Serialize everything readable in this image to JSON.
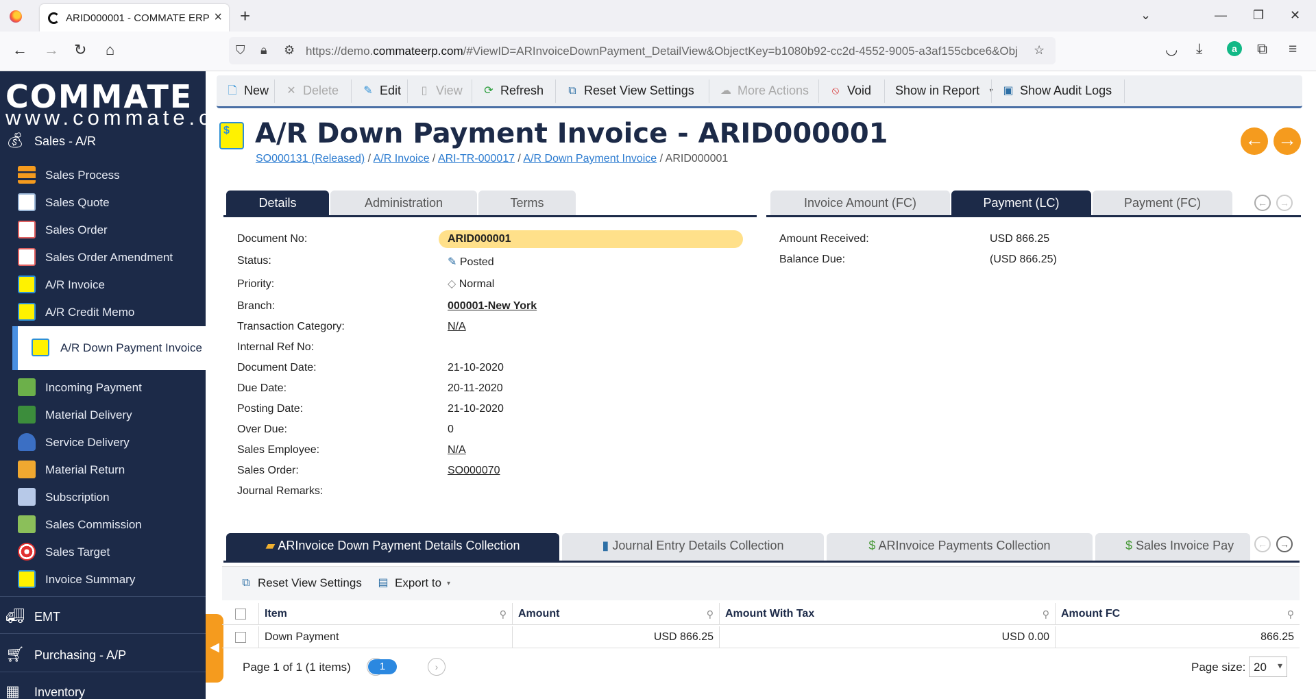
{
  "browser": {
    "tab_title": "ARID000001 - COMMATE ERP",
    "url_prefix": "https://demo.",
    "url_domain": "commateerp.com",
    "url_rest": "/#ViewID=ARInvoiceDownPayment_DetailView&ObjectKey=b1080b92-cc2d-4552-9005-a3af155cbce6&Obj",
    "extension_avatar": "a"
  },
  "sidebar": {
    "brand": "COMMATE",
    "brand_sub": "www.commate.ca",
    "group_sales": "Sales - A/R",
    "items": [
      {
        "label": "Sales Process"
      },
      {
        "label": "Sales Quote"
      },
      {
        "label": "Sales Order"
      },
      {
        "label": "Sales Order Amendment"
      },
      {
        "label": "A/R Invoice"
      },
      {
        "label": "A/R Credit Memo"
      },
      {
        "label": "A/R Down Payment Invoice"
      },
      {
        "label": "Incoming Payment"
      },
      {
        "label": "Material Delivery"
      },
      {
        "label": "Service Delivery"
      },
      {
        "label": "Material Return"
      },
      {
        "label": "Subscription"
      },
      {
        "label": "Sales Commission"
      },
      {
        "label": "Sales Target"
      },
      {
        "label": "Invoice Summary"
      }
    ],
    "group_emt": "EMT",
    "group_purchasing": "Purchasing - A/P",
    "group_inventory": "Inventory",
    "collapse_glyph": "◀"
  },
  "toolbar": {
    "new": "New",
    "delete": "Delete",
    "edit": "Edit",
    "view": "View",
    "refresh": "Refresh",
    "reset_view": "Reset View Settings",
    "more_actions": "More Actions",
    "void": "Void",
    "show_in_report": "Show in Report",
    "show_audit_logs": "Show Audit Logs"
  },
  "title": "A/R Down Payment Invoice - ARID000001",
  "breadcrumb": {
    "c1": "SO000131 (Released)",
    "c2": "A/R Invoice",
    "c3": "ARI-TR-000017",
    "c4": "A/R Down Payment Invoice",
    "current": "ARID000001",
    "sep": " / "
  },
  "tabs_left": [
    "Details",
    "Administration",
    "Terms"
  ],
  "tabs_right": [
    "Invoice Amount (FC)",
    "Payment (LC)",
    "Payment (FC)"
  ],
  "details": {
    "labels": {
      "document_no": "Document No:",
      "status": "Status:",
      "priority": "Priority:",
      "branch": "Branch:",
      "transaction_category": "Transaction Category:",
      "internal_ref": "Internal Ref No:",
      "document_date": "Document Date:",
      "due_date": "Due Date:",
      "posting_date": "Posting Date:",
      "over_due": "Over Due:",
      "sales_employee": "Sales Employee:",
      "sales_order": "Sales Order:",
      "journal_remarks": "Journal Remarks:"
    },
    "values": {
      "document_no": "ARID000001",
      "status": "Posted",
      "priority": "Normal",
      "branch": "000001-New York",
      "transaction_category": "N/A",
      "internal_ref": "",
      "document_date": "21-10-2020",
      "due_date": "20-11-2020",
      "posting_date": "21-10-2020",
      "over_due": "0",
      "sales_employee": "N/A",
      "sales_order": "SO000070",
      "journal_remarks": ""
    }
  },
  "payment": {
    "amount_received_label": "Amount Received:",
    "amount_received": "USD 866.25",
    "balance_due_label": "Balance Due:",
    "balance_due": "(USD 866.25)"
  },
  "collections": {
    "tabs": [
      "ARInvoice Down Payment Details Collection",
      "Journal Entry Details Collection",
      "ARInvoice Payments Collection",
      "Sales Invoice Pay"
    ],
    "reset_view": "Reset View Settings",
    "export_to": "Export to"
  },
  "grid": {
    "columns": [
      "Item",
      "Amount",
      "Amount With Tax",
      "Amount FC"
    ],
    "rows": [
      {
        "item": "Down Payment",
        "amount": "USD 866.25",
        "amount_with_tax": "USD 0.00",
        "amount_fc": "866.25"
      }
    ]
  },
  "pager": {
    "text": "Page 1 of 1 (1 items)",
    "current_page": "1",
    "page_size_label": "Page size:",
    "page_size": "20"
  }
}
